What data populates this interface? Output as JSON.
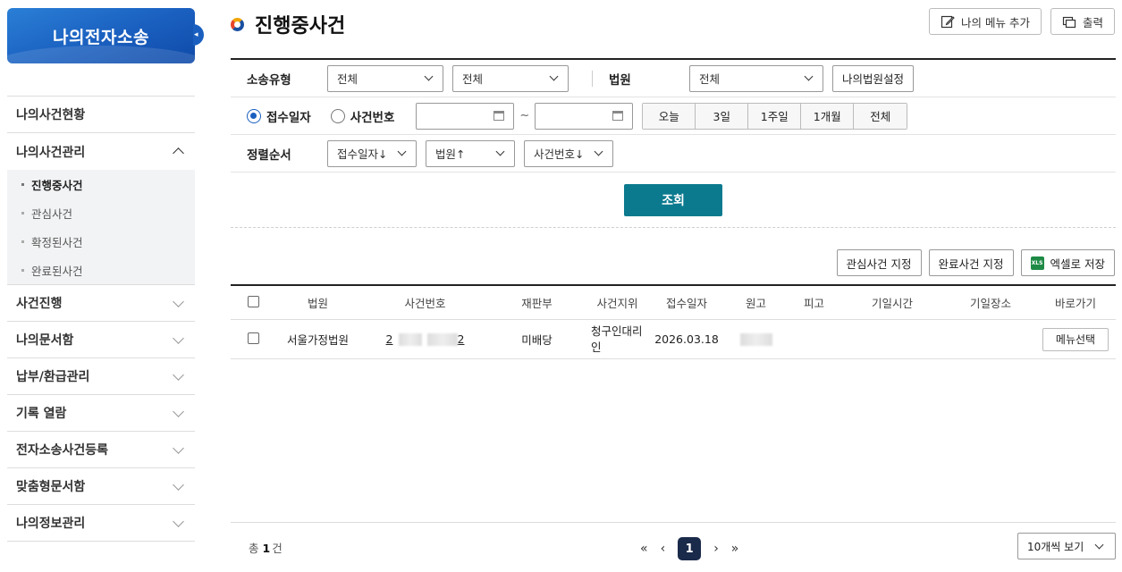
{
  "sidebar": {
    "brand": "나의전자소송",
    "brand_toggle": "◂",
    "menu": [
      {
        "label": "나의사건현황"
      },
      {
        "label": "나의사건관리"
      },
      {
        "label": "사건진행"
      },
      {
        "label": "나의문서함"
      },
      {
        "label": "납부/환급관리"
      },
      {
        "label": "기록 열람"
      },
      {
        "label": "전자소송사건등록"
      },
      {
        "label": "맞춤형문서함"
      },
      {
        "label": "나의정보관리"
      }
    ],
    "submenu": [
      "진행중사건",
      "관심사건",
      "확정된사건",
      "완료된사건"
    ]
  },
  "header": {
    "title": "진행중사건",
    "add_menu": "나의 메뉴 추가",
    "print": "출력"
  },
  "search": {
    "type_label": "소송유형",
    "type_sel1": "전체",
    "type_sel2": "전체",
    "court_label": "법원",
    "court_sel": "전체",
    "court_setting": "나의법원설정",
    "radio_received": "접수일자",
    "radio_caseno": "사건번호",
    "tilde": "~",
    "periods": [
      "오늘",
      "3일",
      "1주일",
      "1개월",
      "전체"
    ],
    "sort_label": "정렬순서",
    "sort1": "접수일자↓",
    "sort2": "법원↑",
    "sort3": "사건번호↓",
    "query": "조회"
  },
  "actions": {
    "interest": "관심사건 지정",
    "complete": "완료사건 지정",
    "excel": "엑셀로 저장",
    "excel_icon": "XLS"
  },
  "table": {
    "headers": [
      "법원",
      "사건번호",
      "재판부",
      "사건지위",
      "접수일자",
      "원고",
      "피고",
      "기일시간",
      "기일장소",
      "바로가기"
    ],
    "rows": [
      {
        "court": "서울가정법원",
        "caseno_start": "2",
        "caseno_end": "2",
        "division": "미배당",
        "status": "청구인대리인",
        "date": "2026.03.18",
        "goto": "메뉴선택"
      }
    ]
  },
  "footer": {
    "total_prefix": "총",
    "total_count": "1",
    "total_suffix": "건",
    "first": "«",
    "prev": "‹",
    "page": "1",
    "next": "›",
    "last": "»",
    "per_page": "10개씩 보기"
  },
  "colors": {
    "brand": "#1a5fbf",
    "query_button": "#0b7a8e",
    "pager_active": "#1a2a4a"
  }
}
